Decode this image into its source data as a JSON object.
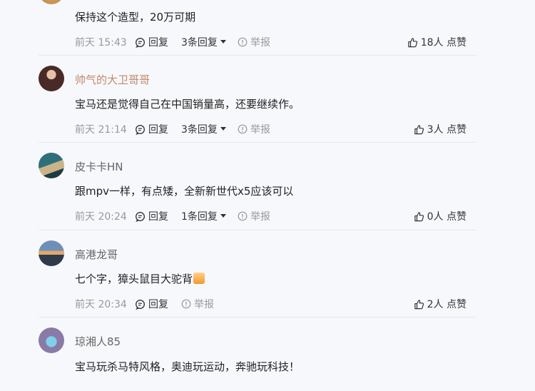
{
  "comments": [
    {
      "text": "保持这个造型，20万可期",
      "time": "前天 15:43",
      "reply": "回复",
      "replies": "",
      "report": "举报",
      "likes": "18人 点赞"
    },
    {
      "user": "帅气的大卫哥哥",
      "text": "宝马还是觉得自己在中国销量高，还要继续作。",
      "time": "前天 21:14",
      "reply": "回复",
      "replies": "3条回复",
      "report": "举报",
      "likes": "3人 点赞"
    },
    {
      "user": "皮卡卡HN",
      "text": "跟mpv一样，有点矮，全新新世代x5应该可以",
      "time": "前天 20:24",
      "reply": "回复",
      "replies": "1条回复",
      "report": "举报",
      "likes": "0人 点赞"
    },
    {
      "user": "高港龙哥",
      "text": "七个字，獐头鼠目大驼背",
      "time": "前天 20:34",
      "reply": "回复",
      "report": "举报",
      "likes": "2人 点赞"
    },
    {
      "user": "琼湘人85",
      "text": "宝马玩杀马特风格，奥迪玩运动，奔驰玩科技！"
    }
  ],
  "first_replies": "3条回复",
  "icons": [
    "reply-icon",
    "caret-down-icon",
    "report-icon",
    "like-icon",
    "thumbs-up-emoji"
  ]
}
